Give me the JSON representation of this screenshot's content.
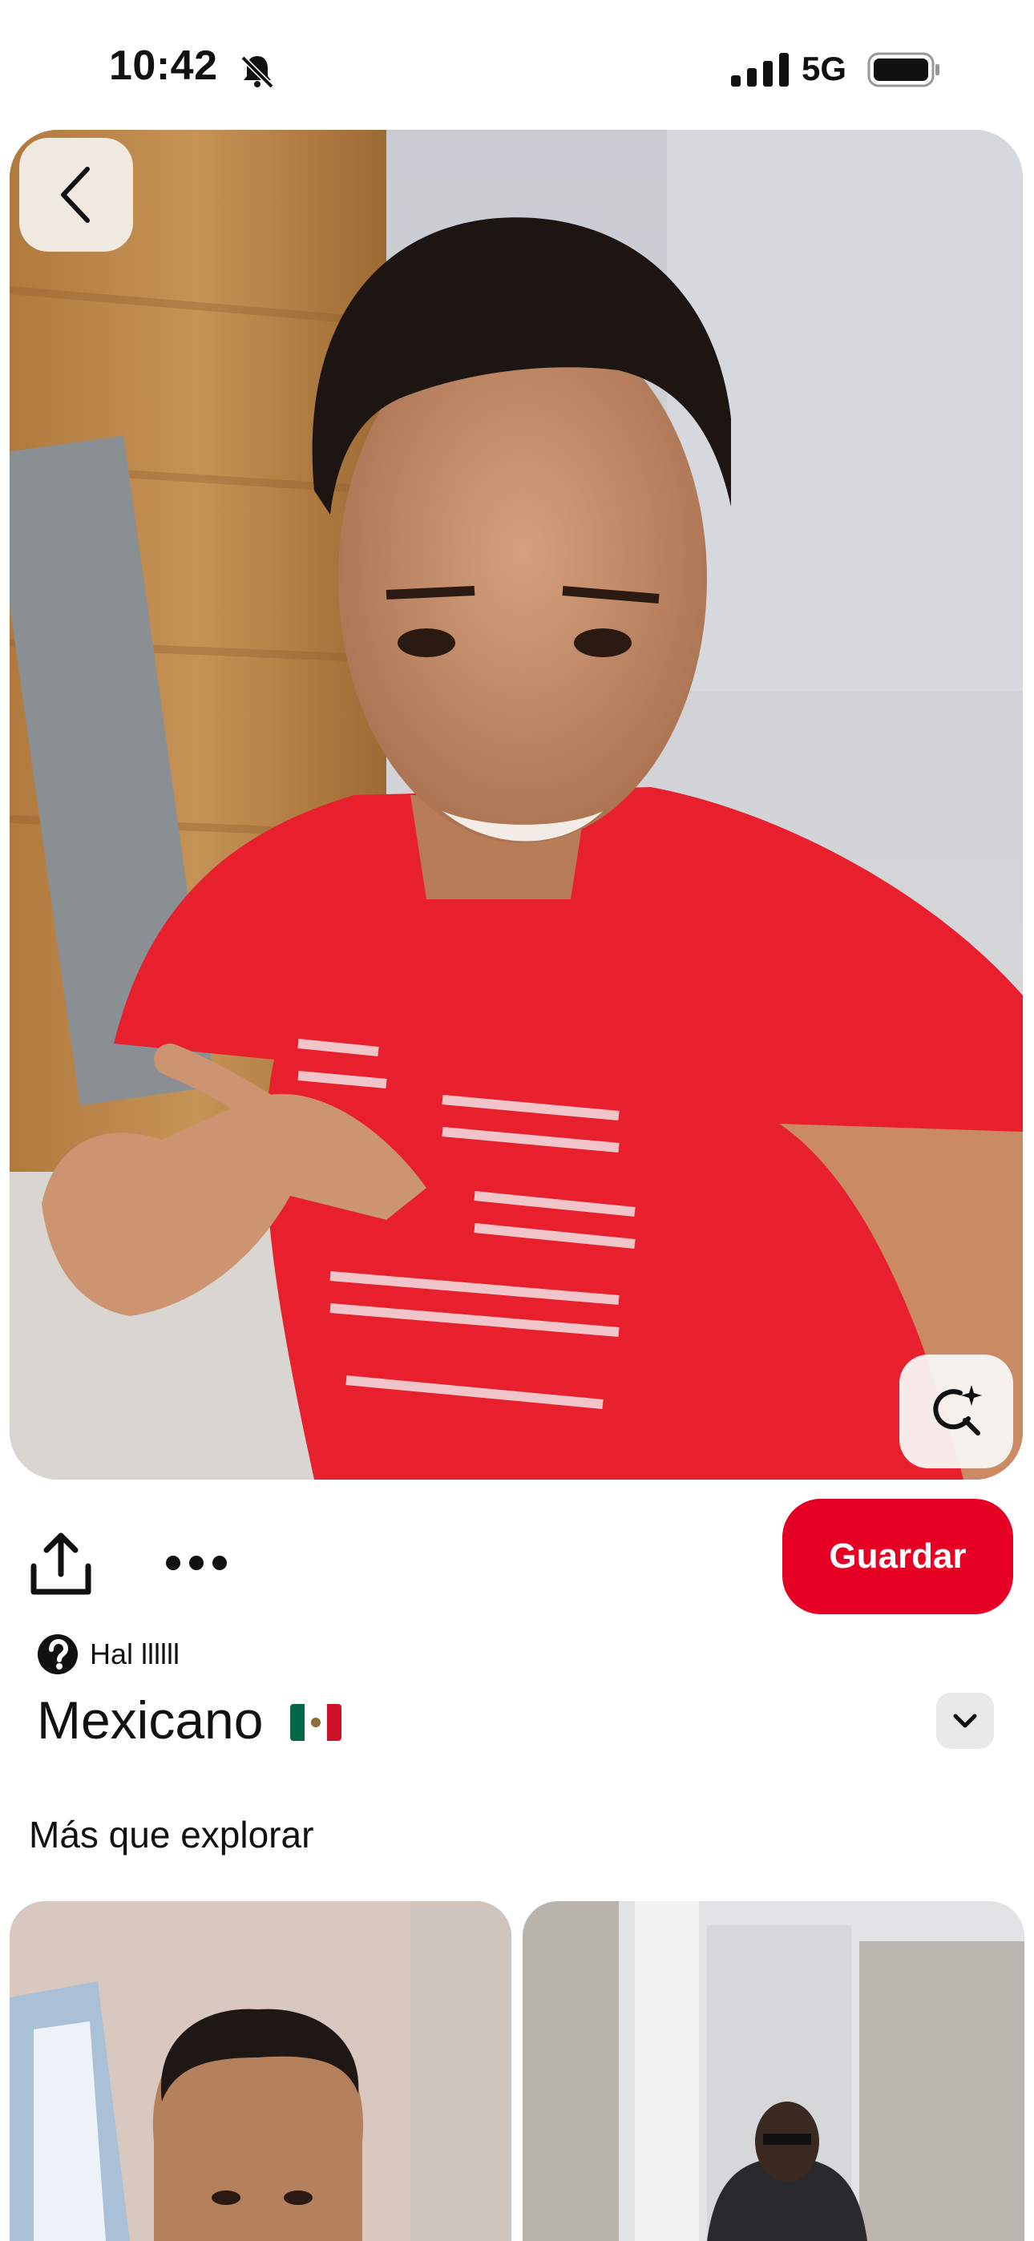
{
  "status_bar": {
    "time": "10:42",
    "network": "5G",
    "icons": [
      "bell-slash-icon",
      "signal-icon",
      "battery-icon"
    ]
  },
  "pin": {
    "image_alt": "",
    "author": "Hal llllll",
    "title": "Mexicano",
    "title_flag": "mexico-flag-icon"
  },
  "actions": {
    "save_label": "Guardar",
    "share_icon": "share-icon",
    "more_icon": "more-dots-icon",
    "back_icon": "chevron-left-icon",
    "lens_icon": "visual-search-icon",
    "expand_icon": "chevron-down-icon"
  },
  "explore": {
    "heading": "Más que explorar",
    "items": [
      {
        "alt": ""
      },
      {
        "alt": ""
      }
    ]
  },
  "colors": {
    "brand_red": "#e60023",
    "text": "#111111",
    "button_gray": "#e9e9e9"
  }
}
